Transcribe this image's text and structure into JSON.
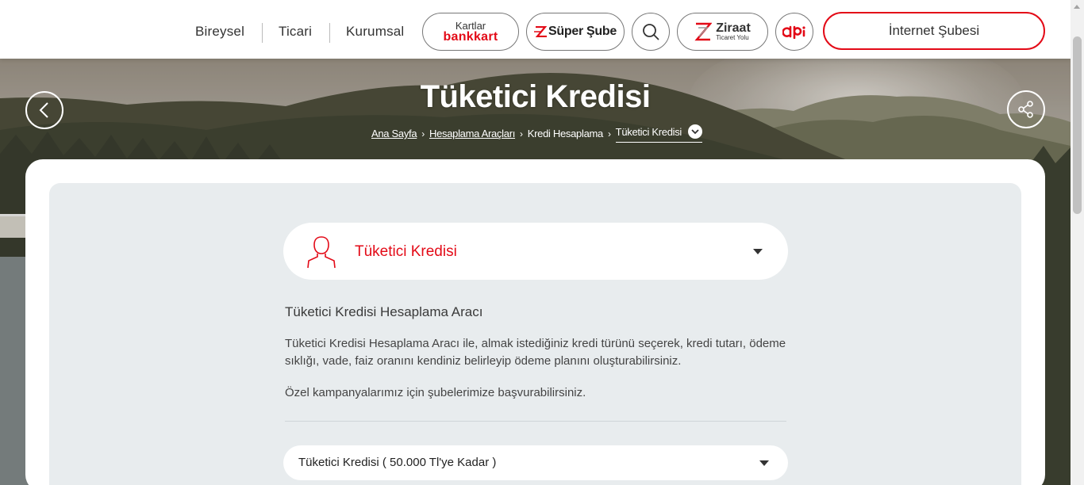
{
  "nav": {
    "links": [
      "Bireysel",
      "Ticari",
      "Kurumsal"
    ],
    "bankkart": {
      "top": "Kartlar",
      "brand": "bankkart"
    },
    "super_sube": "Süper Şube",
    "ziraat": {
      "name": "Ziraat",
      "sub": "Ticaret Yolu"
    },
    "internet_btn": "İnternet Şubesi"
  },
  "hero": {
    "title": "Tüketici Kredisi",
    "breadcrumb": [
      "Ana Sayfa",
      "Hesaplama Araçları",
      "Kredi Hesaplama",
      "Tüketici Kredisi"
    ]
  },
  "calculator": {
    "type_select": "Tüketici Kredisi",
    "title": "Tüketici Kredisi Hesaplama Aracı",
    "desc_1": "Tüketici Kredisi Hesaplama Aracı ile, almak istediğiniz kredi türünü seçerek, kredi tutarı, ödeme sıklığı, vade, faiz oranını kendiniz belirleyip ödeme planını oluşturabilirsiniz.",
    "desc_2": "Özel kampanyalarımız için şubelerimize başvurabilirsiniz.",
    "loan_select": "Tüketici Kredisi ( 50.000 Tl'ye Kadar )"
  },
  "colors": {
    "brand_red": "#e30a17",
    "panel_bg": "#e8ecee"
  }
}
